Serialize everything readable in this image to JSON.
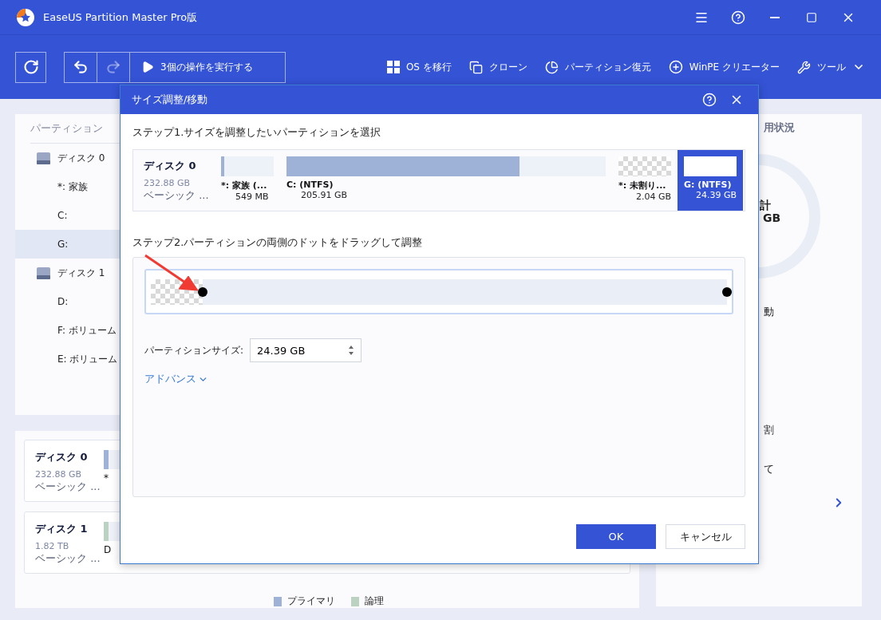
{
  "window": {
    "title": "EaseUS Partition Master Pro版"
  },
  "toolbar": {
    "undo": {
      "disabled": false
    },
    "redo": {
      "disabled": true
    },
    "apply_button": "3個の操作を実行する",
    "actions": [
      {
        "label": "OS を移行",
        "kind": "windows"
      },
      {
        "label": "クローン",
        "kind": "clone"
      },
      {
        "label": "パーティション復元",
        "kind": "restore"
      },
      {
        "label": "WinPE クリエーター",
        "kind": "winpe"
      },
      {
        "label": "ツール",
        "kind": "tools"
      }
    ]
  },
  "partition_panel": {
    "heading": "パーティション",
    "disks": [
      {
        "name": "ディスク 0",
        "children": [
          {
            "name": "*: 家族",
            "selected": false
          },
          {
            "name": "C:",
            "selected": false
          },
          {
            "name": "G:",
            "selected": true
          }
        ]
      },
      {
        "name": "ディスク 1",
        "children": [
          {
            "name": "D:",
            "selected": false
          },
          {
            "name": "F: ボリューム",
            "selected": false
          },
          {
            "name": "E: ボリューム",
            "selected": false
          }
        ]
      }
    ]
  },
  "disk_cards": [
    {
      "name": "ディスク 0",
      "size": "232.88 GB",
      "type": "ベーシック ...",
      "partition_label": "*",
      "kind": "primary"
    },
    {
      "name": "ディスク 1",
      "size": "1.82 TB",
      "type": "ベーシック ...",
      "partition_label": "D",
      "kind": "logical"
    }
  ],
  "legend": [
    {
      "label": "プライマリ",
      "color": "#9db2d6"
    },
    {
      "label": "論理",
      "color": "#bad2bf"
    }
  ],
  "usage_panel": {
    "heading": "用状況",
    "donut_label": "計",
    "donut_value": "GB",
    "actions": [
      "動",
      "割",
      "て"
    ]
  },
  "dialog": {
    "title": "サイズ調整/移動",
    "step1": "ステップ1.サイズを調整したいパーティションを選択",
    "disk": {
      "name": "ディスク 0",
      "size": "232.88 GB",
      "type": "ベーシック ...",
      "partitions": [
        {
          "label": "*: 家族 (...",
          "size": "549 MB",
          "kind": "primary",
          "level": 0.06,
          "selected": false
        },
        {
          "label": "C: (NTFS)",
          "size": "205.91 GB",
          "kind": "primary",
          "level": 0.73,
          "selected": false
        },
        {
          "label": "*: 未割り...",
          "size": "2.04 GB",
          "kind": "unallocated",
          "selected": false
        },
        {
          "label": "G: (NTFS)",
          "size": "24.39 GB",
          "kind": "primary",
          "selected": true
        }
      ]
    },
    "step2": "ステップ2.パーティションの両側のドットをドラッグして調整",
    "slider": {
      "level": 0.91
    },
    "size_label": "パーティションサイズ:",
    "size_value": "24.39 GB",
    "advanced_link": "アドバンス",
    "buttons": [
      {
        "label": "OK",
        "kind": "primary"
      },
      {
        "label": "キャンセル",
        "kind": "secondary"
      }
    ]
  }
}
